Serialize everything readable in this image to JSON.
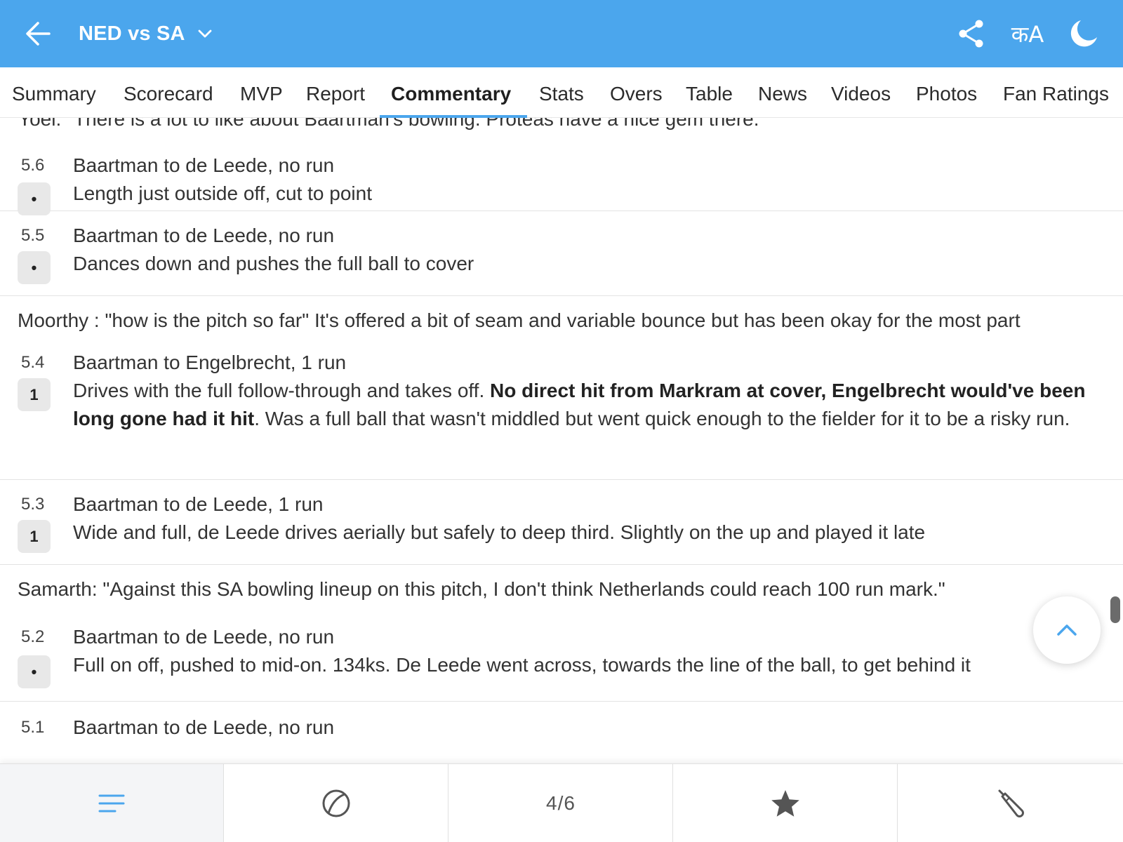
{
  "header": {
    "title": "NED vs SA",
    "lang_label": "कA",
    "color_bg": "#4ba6ed",
    "icons": [
      "back-arrow-icon",
      "chevron-down-icon",
      "share-icon",
      "language-icon",
      "moon-icon"
    ]
  },
  "tabs": [
    {
      "label": "Summary"
    },
    {
      "label": "Scorecard"
    },
    {
      "label": "MVP"
    },
    {
      "label": "Report"
    },
    {
      "label": "Commentary",
      "active": true
    },
    {
      "label": "Stats"
    },
    {
      "label": "Overs"
    },
    {
      "label": "Table"
    },
    {
      "label": "News"
    },
    {
      "label": "Videos"
    },
    {
      "label": "Photos"
    },
    {
      "label": "Fan Ratings"
    }
  ],
  "commentary": {
    "cut_off_text": "Yoel: \"There is a lot to like about Baartman's bowling. Proteas have a nice gem there.\"",
    "balls": [
      {
        "over": "5.6",
        "badge": "•",
        "head": "Baartman to de Leede, no run",
        "desc": "Length just outside off, cut to point"
      },
      {
        "over": "5.5",
        "badge": "•",
        "head": "Baartman to de Leede, no run",
        "desc": "Dances down and pushes the full ball to cover"
      },
      {
        "note": "Moorthy : \"how is the pitch so far\" It's offered a bit of seam and variable bounce but has been okay for the most part"
      },
      {
        "over": "5.4",
        "badge": "1",
        "head": "Baartman to Engelbrecht, 1 run",
        "desc_pre": "Drives with the full follow-through and takes off. ",
        "desc_bold": "No direct hit from Markram at cover, Engelbrecht would've been long gone had it hit",
        "desc_post": ". Was a full ball that wasn't middled but went quick enough to the fielder for it to be a risky run."
      },
      {
        "over": "5.3",
        "badge": "1",
        "head": "Baartman to de Leede, 1 run",
        "desc": "Wide and full, de Leede drives aerially but safely to deep third. Slightly on the up and played it late"
      },
      {
        "note": "Samarth: \"Against this SA bowling lineup on this pitch, I don't think Netherlands could reach 100 run mark.\""
      },
      {
        "over": "5.2",
        "badge": "•",
        "head": "Baartman to de Leede, no run",
        "desc": "Full on off, pushed to mid-on. 134ks. De Leede went across, towards the line of the ball, to get behind it"
      },
      {
        "over": "5.1",
        "head": "Baartman to de Leede, no run"
      }
    ]
  },
  "bottom_bar": {
    "items": [
      {
        "icon": "menu-lines-icon",
        "active": true
      },
      {
        "icon": "cricket-ball-icon"
      },
      {
        "label": "4/6"
      },
      {
        "icon": "star-icon"
      },
      {
        "icon": "cricket-bat-icon"
      }
    ]
  }
}
